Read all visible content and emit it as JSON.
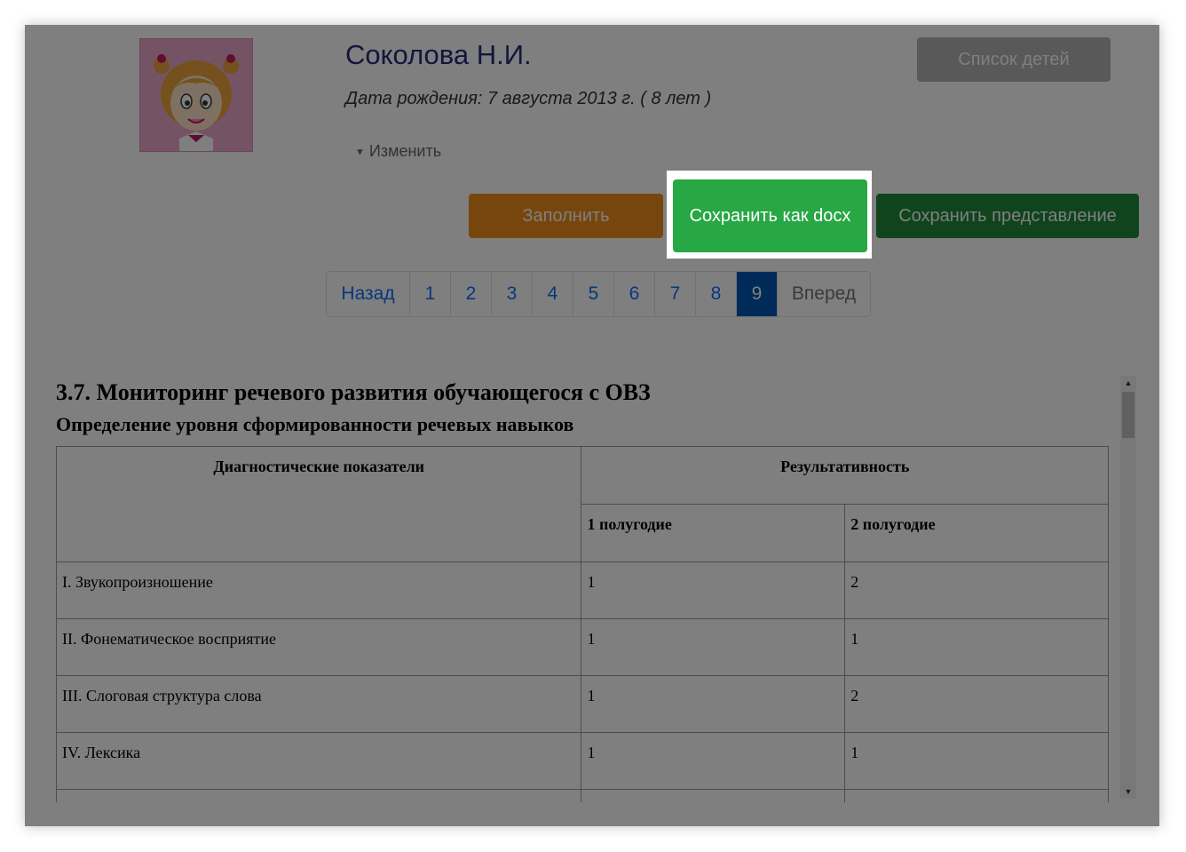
{
  "profile": {
    "name": "Соколова Н.И.",
    "birthdate": "Дата рождения: 7 августа 2013 г. ( 8 лет )",
    "edit_label": "Изменить",
    "edit_icon": "caret-down-icon"
  },
  "buttons": {
    "children_list": "Список детей",
    "fill": "Заполнить",
    "save_docx": "Сохранить как docx",
    "save_view": "Сохранить представление"
  },
  "pagination": {
    "prev": "Назад",
    "pages": [
      "1",
      "2",
      "3",
      "4",
      "5",
      "6",
      "7",
      "8",
      "9"
    ],
    "active": "9",
    "next": "Вперед"
  },
  "document": {
    "title": "3.7. Мониторинг речевого развития обучающегося с ОВЗ",
    "subtitle": "Определение уровня сформированности речевых навыков",
    "table": {
      "header_indicators": "Диагностические показатели",
      "header_results": "Результативность",
      "header_half1": "1 полугодие",
      "header_half2": "2 полугодие",
      "rows": [
        {
          "indicator": "I. Звукопроизношение",
          "half1": "1",
          "half2": "2"
        },
        {
          "indicator": "II. Фонематическое восприятие",
          "half1": "1",
          "half2": "1"
        },
        {
          "indicator": "III. Слоговая структура слова",
          "half1": "1",
          "half2": "2"
        },
        {
          "indicator": "IV. Лексика",
          "half1": "1",
          "half2": "1"
        }
      ]
    }
  },
  "colors": {
    "fill_button": "#ee8d1d",
    "save_docx_button": "#28a745",
    "save_view_button": "#218838",
    "active_page": "#0056b3",
    "name_color": "#262a7c"
  }
}
